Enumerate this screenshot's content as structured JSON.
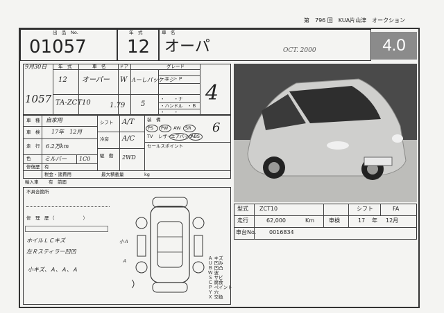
{
  "header": {
    "top_right": "第　796 回　KUA片山津　オークション"
  },
  "row1": {
    "lot_label": "出　品　No.",
    "lot_no": "01057",
    "year_label": "年　式",
    "year": "12",
    "car_label": "車　名",
    "car_name": "オーパ",
    "date_note": "OCT. 2000",
    "grade": "4.0"
  },
  "spec_headers": {
    "year": "年　式",
    "name": "車　名",
    "door": "ドア",
    "grade": "グレード"
  },
  "spec_values": {
    "date": "9月30日",
    "year": "12",
    "name": "オーパー",
    "door": "W",
    "grade": "Aーしパッケージ",
    "lot": "1057",
    "model": "TA-ZCT10",
    "cc": "1.79",
    "seats": "5",
    "score": "4"
  },
  "equip_right": {
    "l1": "・サ　・Ｐ",
    "l2": "・　　・ナ",
    "l3": "・ハンドル　・Ｂ",
    "l4": "・　　・　"
  },
  "grid": {
    "type_label": "車　種",
    "type_value": "自家用",
    "shaken_label": "車　検",
    "shaken_value": "17年　12月",
    "mileage_label": "走　行",
    "mileage_value": "6.2万km",
    "color_label": "色",
    "color_value": "ミルバー",
    "color_code": "1C0",
    "repair_label": "修復歴",
    "repair_value": "有",
    "shift_label": "シフト",
    "shift_value": "A/T",
    "ac_label": "冷房",
    "ac_value": "A/C",
    "drive_label": "駆　動",
    "drive_value": "2WD",
    "equip_label": "装　備",
    "equip_items": [
      "PS",
      "PW",
      "AW",
      "SR",
      "TV",
      "レザー",
      "エアバッグ",
      "ABS"
    ],
    "extra_score": "6",
    "sales_point": "セールスポイント",
    "tax_label": "税金・諸費用",
    "weight_label": "最大積載量",
    "weight_unit": "kg",
    "origin_label": "輸入車",
    "origin_value": "有　前面"
  },
  "lower_left": {
    "hdr": "不具合箇所",
    "fix_label": "修　理　歴",
    "fix_note": "（ 　　　　　　）",
    "notes": [
      "ホイルＬＣキズ",
      "左Ｒスティラー凹凹",
      "小キズ、Ａ、Ａ、Ａ"
    ],
    "diag_marks": [
      "小Ａ",
      "Ａ"
    ]
  },
  "legend": {
    "items": [
      "Ａ キズ",
      "Ｕ 凹み",
      "Ｂ 凹凸",
      "Ｗ 波",
      "Ｓ サビ",
      "Ｃ 腐食",
      "Ｐ ペイント",
      "Ｙ 穴",
      "Ｘ 交換"
    ]
  },
  "info_table": {
    "model_label": "型式",
    "model_value": "ZCT10",
    "shift_label": "シフト",
    "shift_value": "FA",
    "mileage_label": "走行",
    "mileage_value": "62,000",
    "mileage_unit": "Km",
    "inspection_label": "車検",
    "inspection_year": "17",
    "inspection_year_unit": "年",
    "inspection_month": "12月",
    "chassis_label": "車台No.",
    "chassis_value": "0016834"
  },
  "colors": {
    "grade_bg": "#8b8b8b",
    "paper": "#f4f4f2"
  }
}
